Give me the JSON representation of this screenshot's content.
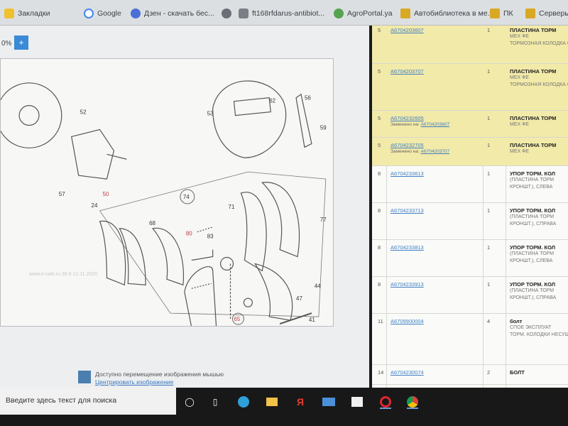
{
  "bookmarks": [
    {
      "label": "Закладки",
      "icon": "bookmark-icon",
      "color": "#f0c02e"
    },
    {
      "label": "Google",
      "icon": "google-icon",
      "color": "#e3e5e8"
    },
    {
      "label": "Дзен - скачать бес...",
      "icon": "zen-icon",
      "color": "#4b6fd6"
    },
    {
      "label": "",
      "icon": "globe-icon",
      "color": "#6a6f75"
    },
    {
      "label": "ft168rfdarus-antibiot...",
      "icon": "site-icon",
      "color": "#7a7f85"
    },
    {
      "label": "AgroPortal.ya",
      "icon": "agroportal-icon",
      "color": "#55a24f"
    },
    {
      "label": "Автобиблиотека в ме...",
      "icon": "folder-icon",
      "color": "#d9a824"
    },
    {
      "label": "ПК",
      "icon": "folder-icon",
      "color": "#d9a824"
    },
    {
      "label": "Серверы",
      "icon": "folder-icon",
      "color": "#d9a824"
    }
  ],
  "viewer": {
    "zoom_label": "0%",
    "zoom_button": "+",
    "diagram_labels": [
      "52",
      "53",
      "56",
      "59",
      "62",
      "24",
      "65",
      "68",
      "71",
      "74",
      "77",
      "80",
      "83",
      "41",
      "44",
      "47",
      "57",
      "50"
    ],
    "watermark": "www.e-cats.ru 30.9 12.11.2020",
    "hint_line1": "Доступно перемещение изображения мышью",
    "hint_link": "Центрировать изображение"
  },
  "parts_table": {
    "rows": [
      {
        "num": "5",
        "code": "A6704203607",
        "qty": "1",
        "desc": "ПЛАСТИНА ТОРМ",
        "sub1": "МЕХ ФЕ",
        "sub2": "ТОРМОЗНАЯ КОЛОДКА СЛЕВА",
        "replaced": "",
        "highlight": true
      },
      {
        "num": "5",
        "code": "A6704203707",
        "qty": "1",
        "desc": "ПЛАСТИНА ТОРМ",
        "sub1": "МЕХ ФЕ",
        "sub2": "ТОРМОЗНАЯ КОЛОДКА СПРАВА",
        "replaced": "",
        "highlight": true
      },
      {
        "num": "5",
        "code": "A6704232605",
        "qty": "1",
        "desc": "ПЛАСТИНА ТОРМ",
        "sub1": "МЕХ ФЕ",
        "sub2": "",
        "replaced": "A6704203607",
        "highlight": true
      },
      {
        "num": "5",
        "code": "A6704232705",
        "qty": "1",
        "desc": "ПЛАСТИНА ТОРМ",
        "sub1": "МЕХ ФЕ",
        "sub2": "",
        "replaced": "A6704203707",
        "highlight": true
      },
      {
        "num": "8",
        "code": "A6704233613",
        "qty": "1",
        "desc": "УПОР ТОРМ. КОЛ",
        "sub1": "(ПЛАСТИНА ТОРМ",
        "sub2": "КРОНШТ.), СЛЕВА",
        "replaced": "",
        "highlight": false
      },
      {
        "num": "8",
        "code": "A6704233713",
        "qty": "1",
        "desc": "УПОР ТОРМ. КОЛ",
        "sub1": "(ПЛАСТИНА ТОРМ",
        "sub2": "КРОНШТ.), СПРАВА",
        "replaced": "",
        "highlight": false
      },
      {
        "num": "8",
        "code": "A6704233813",
        "qty": "1",
        "desc": "УПОР ТОРМ. КОЛ",
        "sub1": "(ПЛАСТИНА ТОРМ",
        "sub2": "КРОНШТ.), СЛЕВА",
        "replaced": "",
        "highlight": false
      },
      {
        "num": "8",
        "code": "A6704233913",
        "qty": "1",
        "desc": "УПОР ТОРМ. КОЛ",
        "sub1": "(ПЛАСТИНА ТОРМ",
        "sub2": "КРОНШТ.), СПРАВА",
        "replaced": "",
        "highlight": false
      },
      {
        "num": "11",
        "code": "A6709900004",
        "qty": "4",
        "desc": "болт",
        "sub1": "СПОЕ ЭКСПЛУАТ",
        "sub2": "ТОРМ. КОЛОДКИ НЕСУЩ. ПЛАСТИНЕ",
        "replaced": "",
        "highlight": false
      },
      {
        "num": "14",
        "code": "A6704230074",
        "qty": "2",
        "desc": "БОЛТ",
        "sub1": "",
        "sub2": "",
        "replaced": "",
        "highlight": false
      }
    ],
    "replaced_prefix": "Заменено на:"
  },
  "taskbar": {
    "search_placeholder": "Введите здесь текст для поиска",
    "icons": [
      "search-circle-icon",
      "task-view-icon",
      "edge-icon",
      "file-explorer-icon",
      "yandex-icon",
      "mail-icon",
      "store-icon",
      "opera-icon",
      "chrome-icon"
    ]
  }
}
